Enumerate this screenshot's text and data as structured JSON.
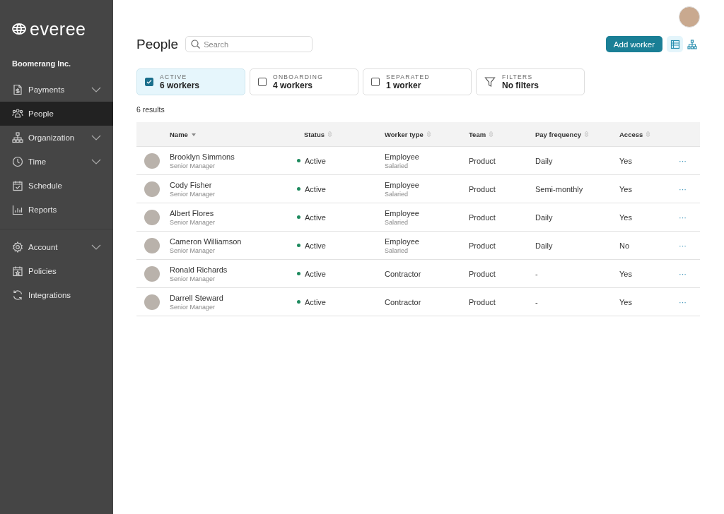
{
  "brand": {
    "name": "everee"
  },
  "company": "Boomerang Inc.",
  "nav_groups": [
    [
      {
        "label": "Payments",
        "kind": "document",
        "expandable": true,
        "selected": false
      },
      {
        "label": "People",
        "kind": "people",
        "expandable": false,
        "selected": true
      },
      {
        "label": "Organization",
        "kind": "hierarchy",
        "expandable": true,
        "selected": false
      },
      {
        "label": "Time",
        "kind": "clock",
        "expandable": true,
        "selected": false
      },
      {
        "label": "Schedule",
        "kind": "calendar-check",
        "expandable": false,
        "selected": false
      },
      {
        "label": "Reports",
        "kind": "bar-chart",
        "expandable": false,
        "selected": false
      }
    ],
    [
      {
        "label": "Account",
        "kind": "gear",
        "expandable": true,
        "selected": false
      },
      {
        "label": "Policies",
        "kind": "calendar-star",
        "expandable": false,
        "selected": false
      },
      {
        "label": "Integrations",
        "kind": "refresh",
        "expandable": false,
        "selected": false
      }
    ]
  ],
  "page_title": "People",
  "search": {
    "placeholder": "Search"
  },
  "add_button": "Add worker",
  "views": [
    {
      "kind": "table",
      "selected": true
    },
    {
      "kind": "org",
      "selected": false
    }
  ],
  "chips": [
    {
      "kind": "checkbox",
      "label": "ACTIVE",
      "value": "6 workers",
      "checked": true
    },
    {
      "kind": "checkbox",
      "label": "ONBOARDING",
      "value": "4 workers",
      "checked": false
    },
    {
      "kind": "checkbox",
      "label": "SEPARATED",
      "value": "1 worker",
      "checked": false
    },
    {
      "kind": "filter",
      "label": "FILTERS",
      "value": "No filters"
    }
  ],
  "results": "6 results",
  "table": {
    "columns": [
      {
        "label": "Name",
        "sorted": true
      },
      {
        "label": "Status",
        "sorted": false
      },
      {
        "label": "Worker type",
        "sorted": false
      },
      {
        "label": "Team",
        "sorted": false
      },
      {
        "label": "Pay frequency",
        "sorted": false
      },
      {
        "label": "Access",
        "sorted": false
      }
    ],
    "rows": [
      {
        "name": "Brooklyn Simmons",
        "title": "Senior Manager",
        "status": "Active",
        "color": "#1e8a5e",
        "type": "Employee",
        "subtype": "Salaried",
        "team": "Product",
        "pay": "Daily",
        "access": "Yes",
        "menu": "···"
      },
      {
        "name": "Cody Fisher",
        "title": "Senior Manager",
        "status": "Active",
        "color": "#1e8a5e",
        "type": "Employee",
        "subtype": "Salaried",
        "team": "Product",
        "pay": "Semi-monthly",
        "access": "Yes",
        "menu": "···"
      },
      {
        "name": "Albert Flores",
        "title": "Senior Manager",
        "status": "Active",
        "color": "#1e8a5e",
        "type": "Employee",
        "subtype": "Salaried",
        "team": "Product",
        "pay": "Daily",
        "access": "Yes",
        "menu": "···"
      },
      {
        "name": "Cameron Williamson",
        "title": "Senior Manager",
        "status": "Active",
        "color": "#1e8a5e",
        "type": "Employee",
        "subtype": "Salaried",
        "team": "Product",
        "pay": "Daily",
        "access": "No",
        "menu": "···"
      },
      {
        "name": "Ronald Richards",
        "title": "Senior Manager",
        "status": "Active",
        "color": "#1e8a5e",
        "type": "Contractor",
        "team": "Product",
        "pay": "-",
        "access": "Yes",
        "menu": "···"
      },
      {
        "name": "Darrell Steward",
        "title": "Senior Manager",
        "status": "Active",
        "color": "#1e8a5e",
        "type": "Contractor",
        "team": "Product",
        "pay": "-",
        "access": "Yes",
        "menu": "···"
      }
    ]
  }
}
